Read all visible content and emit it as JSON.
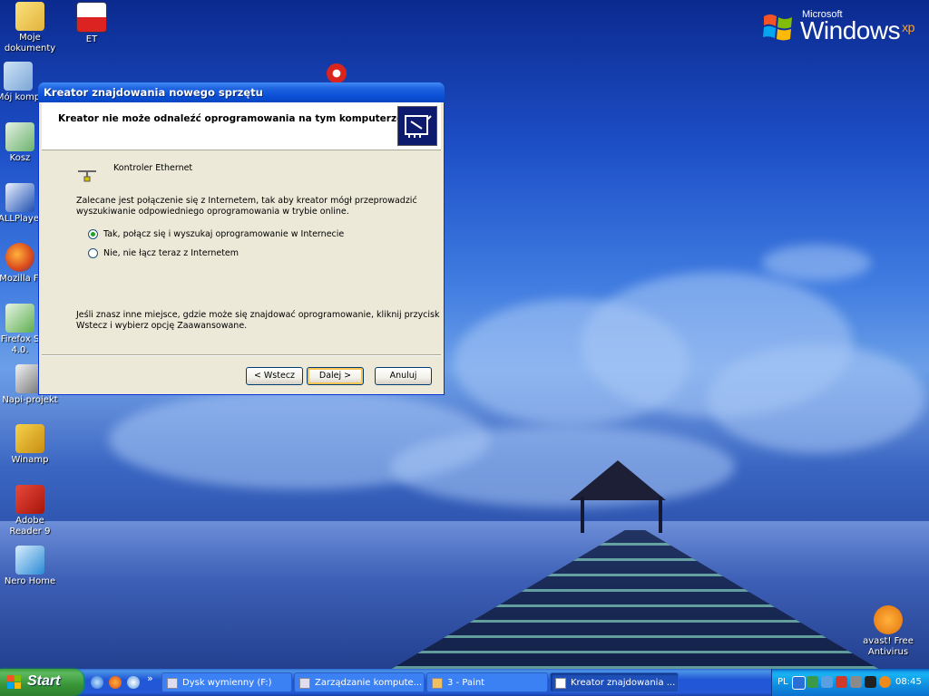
{
  "desktop": {
    "brand": {
      "microsoft": "Microsoft",
      "windows": "Windows",
      "xp": "xp"
    },
    "icons": [
      {
        "label": "Moje dokumenty",
        "icon": "folder-documents-icon"
      },
      {
        "label": "ET",
        "icon": "flag-icon"
      },
      {
        "label": "Mój komp",
        "icon": "computer-icon"
      },
      {
        "label": "Kosz",
        "icon": "recycle-bin-icon"
      },
      {
        "label": "ALLPlayer",
        "icon": "allplayer-icon"
      },
      {
        "label": "Mozilla Fi",
        "icon": "firefox-icon"
      },
      {
        "label": "Firefox S 4.0.",
        "icon": "firefox-setup-icon"
      },
      {
        "label": "Napi-projekt",
        "icon": "napiprojekt-icon"
      },
      {
        "label": "Winamp",
        "icon": "winamp-icon"
      },
      {
        "label": "Adobe Reader 9",
        "icon": "adobe-reader-icon"
      },
      {
        "label": "Nero Home",
        "icon": "nero-home-icon"
      },
      {
        "label": "avast! Free Antivirus",
        "icon": "avast-icon"
      }
    ]
  },
  "window": {
    "title": "Kreator znajdowania nowego sprzętu",
    "header": "Kreator nie może odnaleźć oprogramowania na tym komputerze dla...",
    "device": "Kontroler Ethernet",
    "intro_line1": "Zalecane jest połączenie się z Internetem, tak aby kreator mógł przeprowadzić",
    "intro_line2": "wyszukiwanie odpowiedniego oprogramowania w trybie online.",
    "option_yes": "Tak, połącz się i wyszukaj oprogramowanie w Internecie",
    "option_no": "Nie, nie łącz teraz z Internetem",
    "selected_option": "yes",
    "hint_line1": "Jeśli znasz inne miejsce, gdzie może się znajdować oprogramowanie, kliknij przycisk",
    "hint_line2": "Wstecz i wybierz opcję Zaawansowane.",
    "buttons": {
      "back": "< Wstecz",
      "next": "Dalej >",
      "cancel": "Anuluj"
    }
  },
  "taskbar": {
    "start": "Start",
    "chevron": "»",
    "tasks": [
      {
        "label": "Dysk wymienny (F:)",
        "active": false
      },
      {
        "label": "Zarządzanie kompute...",
        "active": false
      },
      {
        "label": "3 - Paint",
        "active": false
      },
      {
        "label": "Kreator znajdowania ...",
        "active": true
      }
    ],
    "tray": {
      "language": "PL",
      "clock": "08:45"
    }
  },
  "colors": {
    "title_bar": "#0a4fd6",
    "dialog_face": "#ece9d8",
    "taskbar": "#2358d8",
    "start_button": "#379537",
    "tray": "#0f8fe1"
  }
}
